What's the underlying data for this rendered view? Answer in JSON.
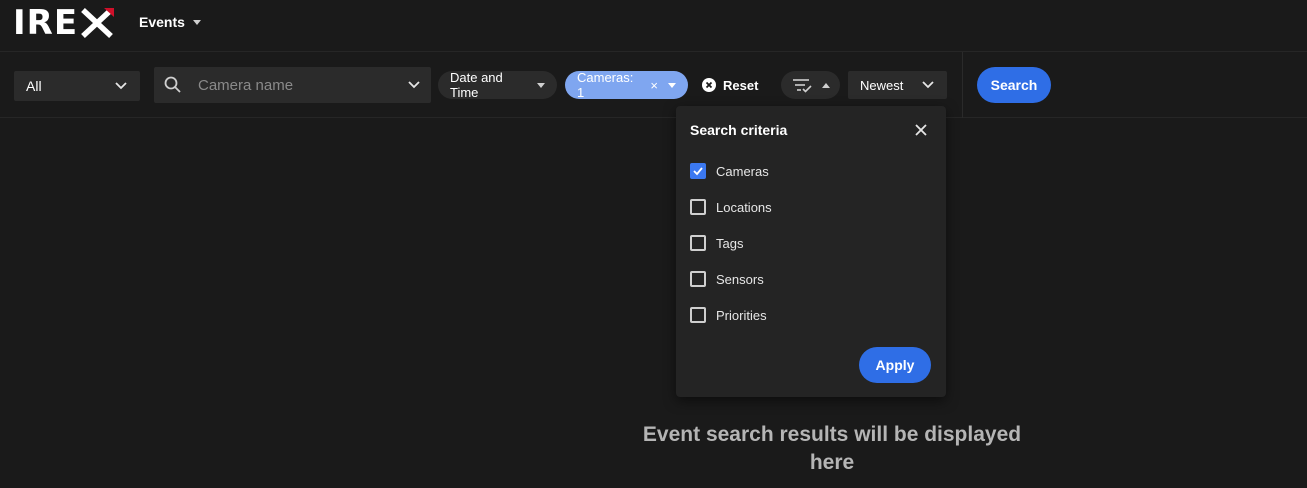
{
  "header": {
    "logo_text": "IRE",
    "nav_label": "Events"
  },
  "filters": {
    "scope_select": "All",
    "search_placeholder": "Camera name",
    "date_chip": "Date and Time",
    "cameras_chip": "Cameras: 1",
    "cameras_chip_clear": "×",
    "reset_label": "Reset",
    "sort_select": "Newest",
    "search_button": "Search"
  },
  "criteria_panel": {
    "title": "Search criteria",
    "options": [
      {
        "label": "Cameras",
        "checked": true
      },
      {
        "label": "Locations",
        "checked": false
      },
      {
        "label": "Tags",
        "checked": false
      },
      {
        "label": "Sensors",
        "checked": false
      },
      {
        "label": "Priorities",
        "checked": false
      }
    ],
    "apply_button": "Apply"
  },
  "main": {
    "empty_message": "Event search results will be displayed here"
  },
  "colors": {
    "background": "#1a1a1a",
    "primary": "#2f6ee6",
    "chip_active": "#7fa6f0",
    "logo_accent": "#d0102a"
  },
  "icons": {
    "search": "search-icon",
    "close": "close-icon",
    "filter": "filter-check-icon",
    "reset": "clear-circle-icon",
    "chevron": "chevron-down-icon",
    "check": "check-icon"
  }
}
